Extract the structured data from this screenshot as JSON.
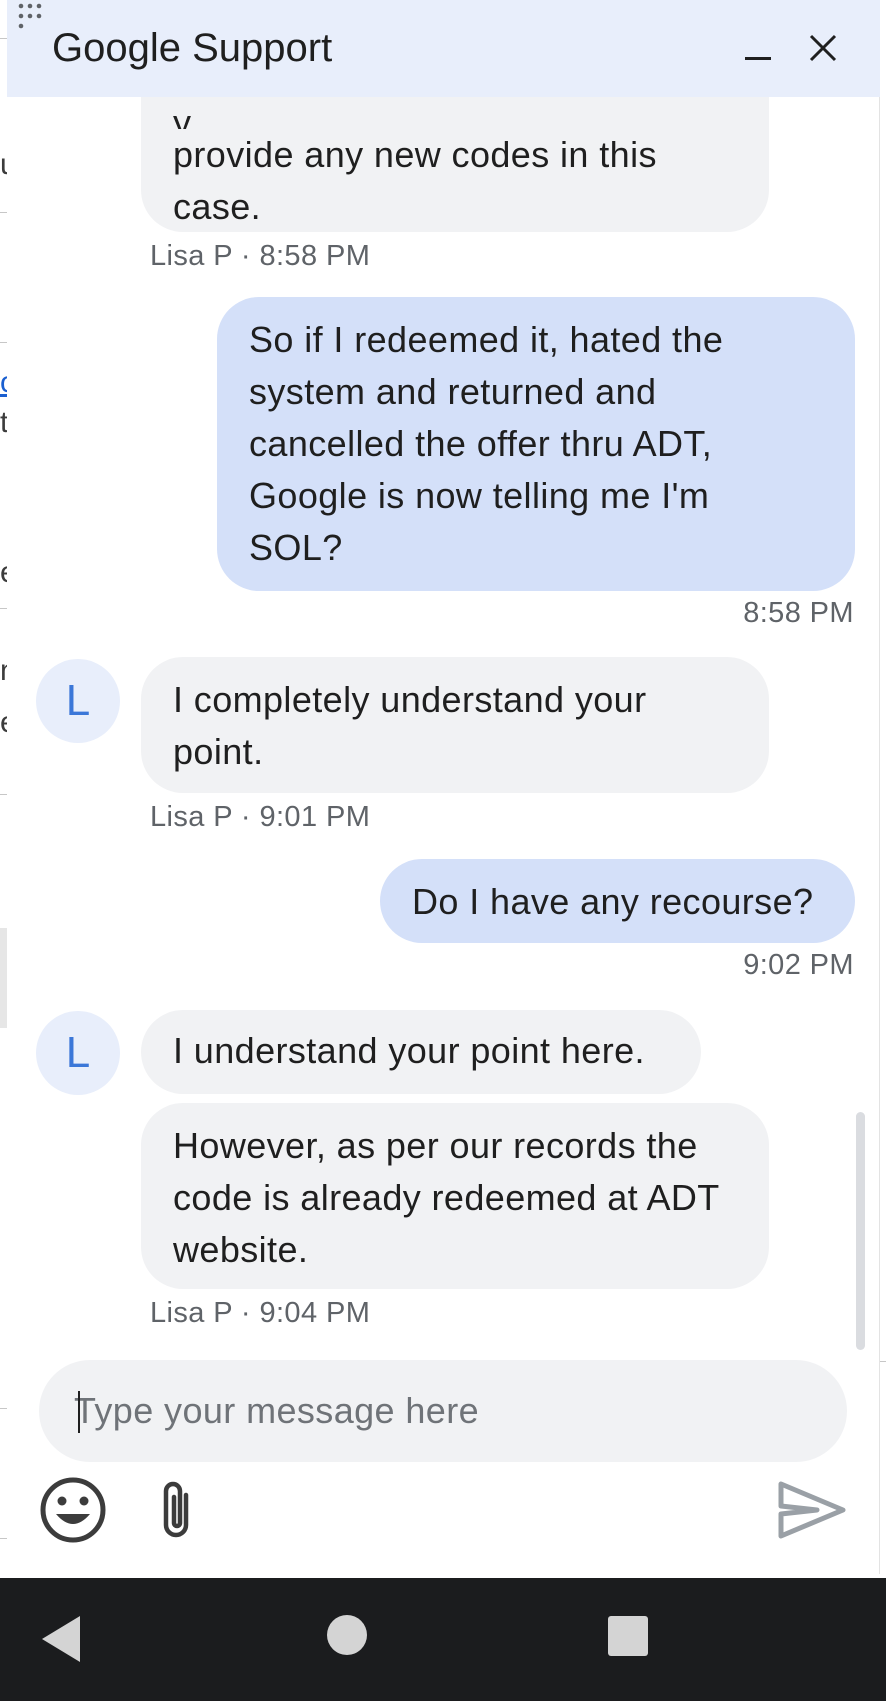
{
  "header": {
    "title": "Google Support",
    "minimize_icon": "minimize-icon",
    "close_icon": "close-icon"
  },
  "messages": [
    {
      "sender": "agent",
      "lines": [
        "provide any new codes in this",
        "case."
      ],
      "meta": "Lisa P · 8:58 PM"
    },
    {
      "sender": "user",
      "lines": [
        "So if I redeemed it, hated the",
        "system and returned and",
        "cancelled the offer thru ADT,",
        "Google is now telling me I'm",
        "SOL?"
      ],
      "meta": "8:58 PM"
    },
    {
      "sender": "agent",
      "avatar": "L",
      "lines": [
        "I completely understand your",
        "point."
      ],
      "meta": "Lisa P · 9:01 PM"
    },
    {
      "sender": "user",
      "lines": [
        "Do I have any recourse?"
      ],
      "meta": "9:02 PM"
    },
    {
      "sender": "agent",
      "avatar": "L",
      "lines": [
        "I understand your point here."
      ]
    },
    {
      "sender": "agent",
      "lines": [
        "However, as per our records the",
        "code is already redeemed at ADT",
        "website."
      ],
      "meta": "Lisa P · 9:04 PM"
    }
  ],
  "composer": {
    "placeholder": "Type your message here",
    "value": ""
  },
  "toolbar": {
    "emoji_icon": "emoji-icon",
    "attach_icon": "attach-icon",
    "send_icon": "send-icon"
  },
  "nav": {
    "back_icon": "back-icon",
    "home_icon": "home-icon",
    "recents_icon": "recents-icon"
  },
  "background": {
    "fragments": [
      "u",
      "o",
      "t",
      "e",
      "n",
      "e"
    ]
  },
  "colors": {
    "header_bg": "#e8eefb",
    "user_bubble": "#d4e0f9",
    "agent_bubble": "#f1f2f4",
    "avatar_text": "#3b77d8",
    "nav_bar": "#1b1c1e"
  }
}
